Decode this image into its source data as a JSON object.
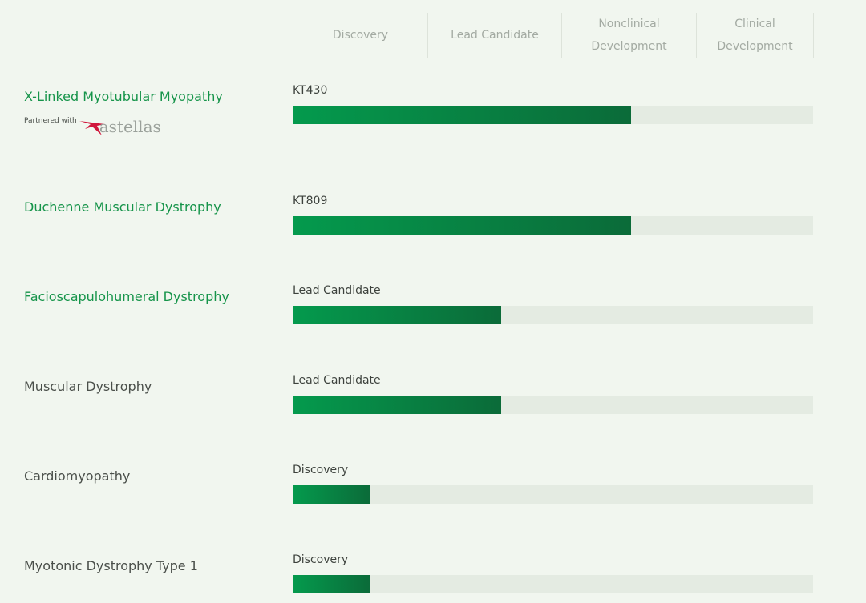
{
  "stages": [
    {
      "label": "Discovery"
    },
    {
      "label": "Lead Candidate"
    },
    {
      "label": "Nonclinical\nDevelopment"
    },
    {
      "label": "Clinical\nDevelopment"
    }
  ],
  "programs": [
    {
      "name": "X-Linked Myotubular Myopathy",
      "stage_label": "KT430",
      "progress": 0.65,
      "highlight": true
    },
    {
      "name": "Duchenne Muscular Dystrophy",
      "stage_label": "KT809",
      "progress": 0.65,
      "highlight": true
    },
    {
      "name": "Facioscapulohumeral Dystrophy",
      "stage_label": "Lead Candidate",
      "progress": 0.4,
      "highlight": true
    },
    {
      "name": "Muscular Dystrophy",
      "stage_label": "Lead Candidate",
      "progress": 0.4,
      "highlight": false
    },
    {
      "name": "Cardiomyopathy",
      "stage_label": "Discovery",
      "progress": 0.15,
      "highlight": false
    },
    {
      "name": "Myotonic Dystrophy Type 1",
      "stage_label": "Discovery",
      "progress": 0.15,
      "highlight": false
    }
  ],
  "partner": {
    "label": "Partnered with",
    "name": "astellas",
    "logo_color": "#d1173c"
  },
  "colors": {
    "accent": "#16944a",
    "bar_start": "#049a4d",
    "bar_end": "#0b6b39",
    "track": "#e4ebe2",
    "background": "#f1f6ef"
  }
}
